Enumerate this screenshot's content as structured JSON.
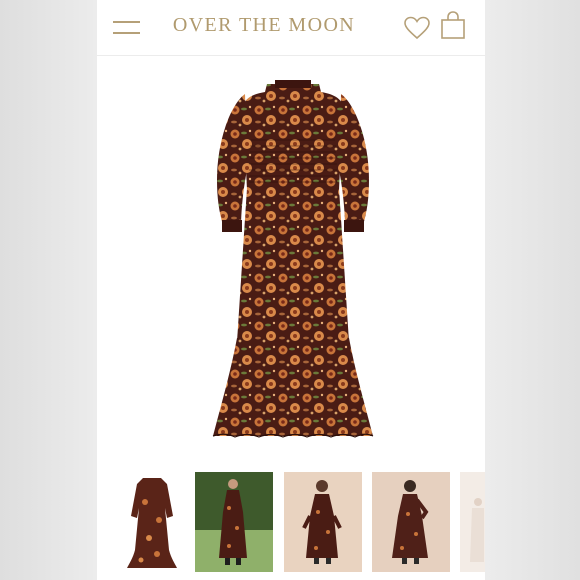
{
  "header": {
    "brand": "OVER THE MOON",
    "menu_icon": "hamburger-menu-icon",
    "wishlist_icon": "heart-icon",
    "cart_icon": "shopping-bag-icon"
  },
  "product": {
    "main_image": "floral-maxi-dress-image"
  },
  "thumbnails": [
    {
      "name": "thumbnail-dress-flat"
    },
    {
      "name": "thumbnail-model-garden"
    },
    {
      "name": "thumbnail-model-front"
    },
    {
      "name": "thumbnail-model-pose"
    },
    {
      "name": "thumbnail-partial"
    }
  ],
  "colors": {
    "brand": "#b09a6e",
    "dress_base": "#4a1c14",
    "dress_pattern": "#c8743a"
  }
}
